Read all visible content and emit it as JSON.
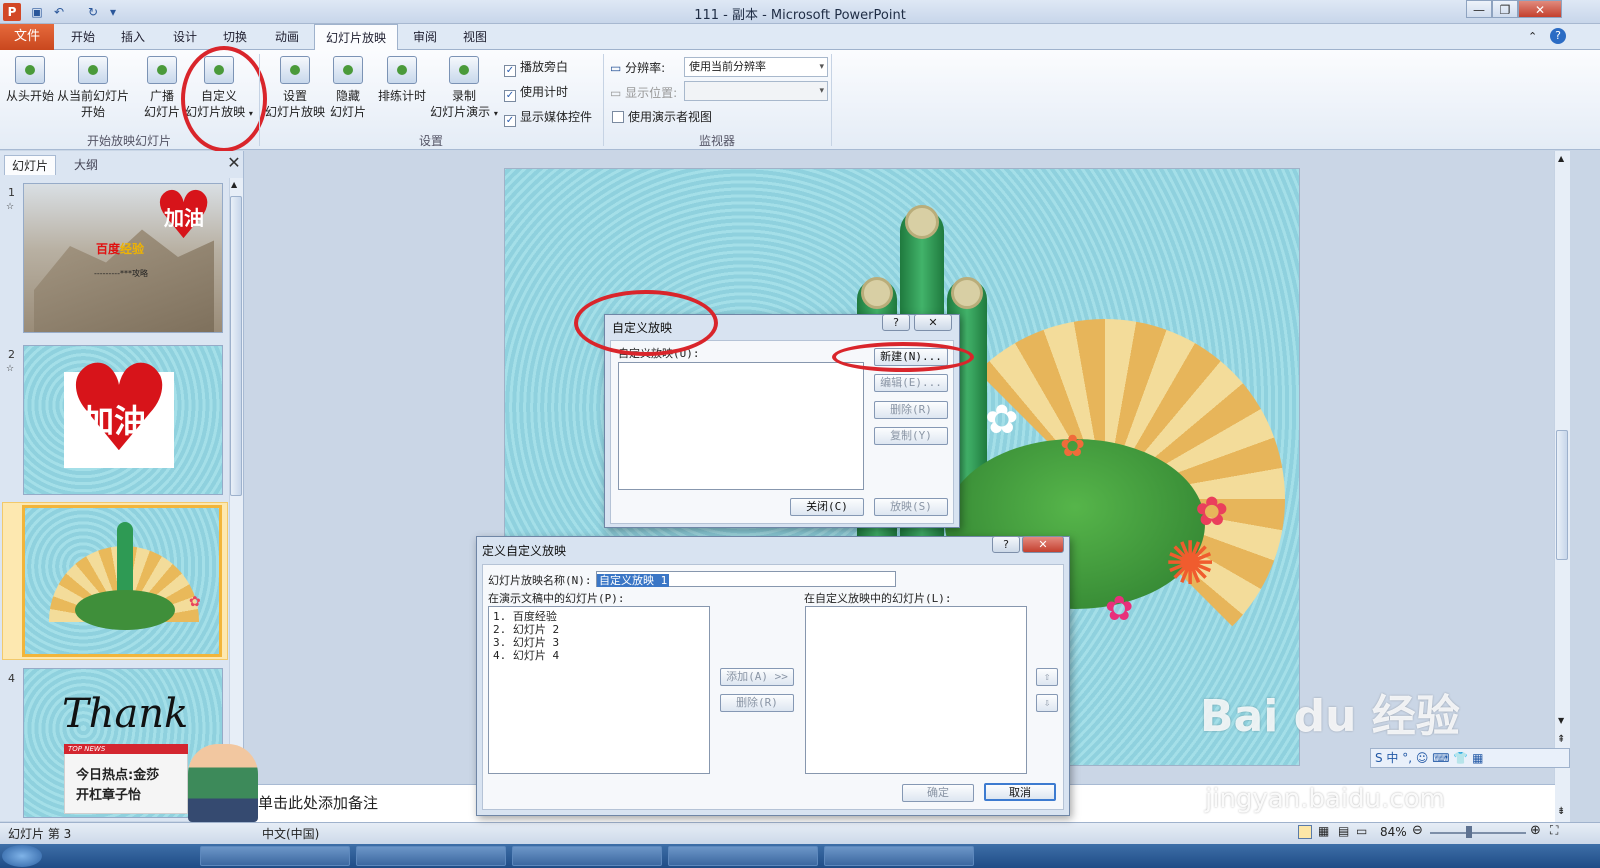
{
  "window": {
    "title": "111 - 副本 - Microsoft PowerPoint",
    "app_letter": "P"
  },
  "tabs": [
    "文件",
    "开始",
    "插入",
    "设计",
    "切换",
    "动画",
    "幻灯片放映",
    "审阅",
    "视图"
  ],
  "ribbon": {
    "start_group": {
      "label": "开始放映幻灯片",
      "from_start": "从头开始",
      "from_current_1": "从当前幻灯片",
      "from_current_2": "开始",
      "broadcast_1": "广播",
      "broadcast_2": "幻灯片",
      "custom_1": "自定义",
      "custom_2": "幻灯片放映"
    },
    "setup_group": {
      "label": "设置",
      "setup_1": "设置",
      "setup_2": "幻灯片放映",
      "hide_1": "隐藏",
      "hide_2": "幻灯片",
      "rehearse": "排练计时",
      "record_1": "录制",
      "record_2": "幻灯片演示",
      "play_narration": "播放旁白",
      "use_timings": "使用计时",
      "show_media": "显示媒体控件"
    },
    "monitor_group": {
      "label": "监视器",
      "resolution_label": "分辨率:",
      "resolution_value": "使用当前分辨率",
      "display_on_label": "显示位置:",
      "presenter_view": "使用演示者视图"
    }
  },
  "left_pane": {
    "tab_slides": "幻灯片",
    "tab_outline": "大纲",
    "slides": [
      {
        "num": "1",
        "heart_text": "加油",
        "title_red": "百度",
        "title_yellow": "经验",
        "subtitle": "---------***攻略"
      },
      {
        "num": "2",
        "heart_text": "加油"
      },
      {
        "num": "3"
      },
      {
        "num": "4",
        "script_text": "Thank"
      }
    ]
  },
  "notes": {
    "placeholder": "单击此处添加备注"
  },
  "status": {
    "slide_info": "幻灯片 第 3",
    "language": "中文(中国)",
    "zoom": "84%"
  },
  "custom_shows_dialog": {
    "title": "自定义放映",
    "list_label": "自定义放映(U):",
    "new": "新建(N)...",
    "edit": "编辑(E)...",
    "remove": "删除(R)",
    "copy": "复制(Y)",
    "close": "关闭(C)",
    "show": "放映(S)"
  },
  "define_show_dialog": {
    "title": "定义自定义放映",
    "name_label": "幻灯片放映名称(N):",
    "name_value": "自定义放映 1",
    "left_label": "在演示文稿中的幻灯片(P):",
    "right_label": "在自定义放映中的幻灯片(L):",
    "slides": [
      "1. 百度经验",
      "2. 幻灯片 2",
      "3. 幻灯片 3",
      "4. 幻灯片 4"
    ],
    "add": "添加(A) >>",
    "remove": "删除(R)",
    "ok": "确定",
    "cancel": "取消"
  },
  "overlay_ad": {
    "tag": "TOP NEWS",
    "line1": "今日热点:金莎",
    "line2": "开杠章子怡"
  },
  "watermark": {
    "brand": "Bai du 经验",
    "url": "jingyan.baidu.com"
  },
  "colors": {
    "file_tab": "#d24726",
    "highlight_circle": "#d9252b",
    "selected_thumb": "#f2b53a"
  }
}
